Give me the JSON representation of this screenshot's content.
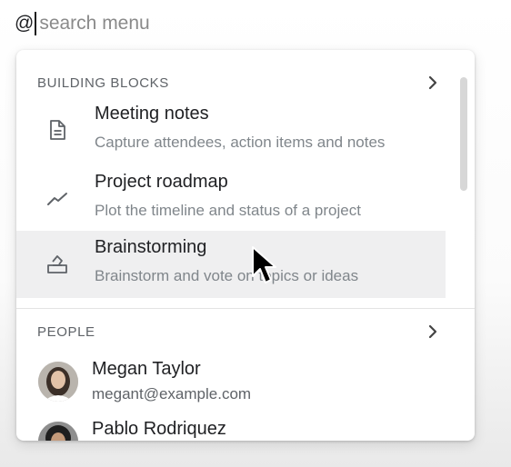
{
  "search": {
    "prefix": "@",
    "placeholder": "search menu",
    "value": ""
  },
  "menu": {
    "sections": [
      {
        "title": "BUILDING BLOCKS",
        "items": [
          {
            "title": "Meeting notes",
            "description": "Capture attendees, action items and notes",
            "icon": "document-icon"
          },
          {
            "title": "Project roadmap",
            "description": "Plot the timeline and status of a project",
            "icon": "trend-line-icon"
          },
          {
            "title": "Brainstorming",
            "description": "Brainstorm and vote on topics or ideas",
            "icon": "ballot-box-icon",
            "hovered": true
          }
        ]
      },
      {
        "title": "PEOPLE",
        "people": [
          {
            "name": "Megan Taylor",
            "email": "megant@example.com"
          },
          {
            "name": "Pablo Rodriquez",
            "email": ""
          }
        ]
      }
    ]
  },
  "colors": {
    "hover_row": "#efeff0",
    "secondary_text": "#80868b",
    "section_header": "#5f6368"
  }
}
